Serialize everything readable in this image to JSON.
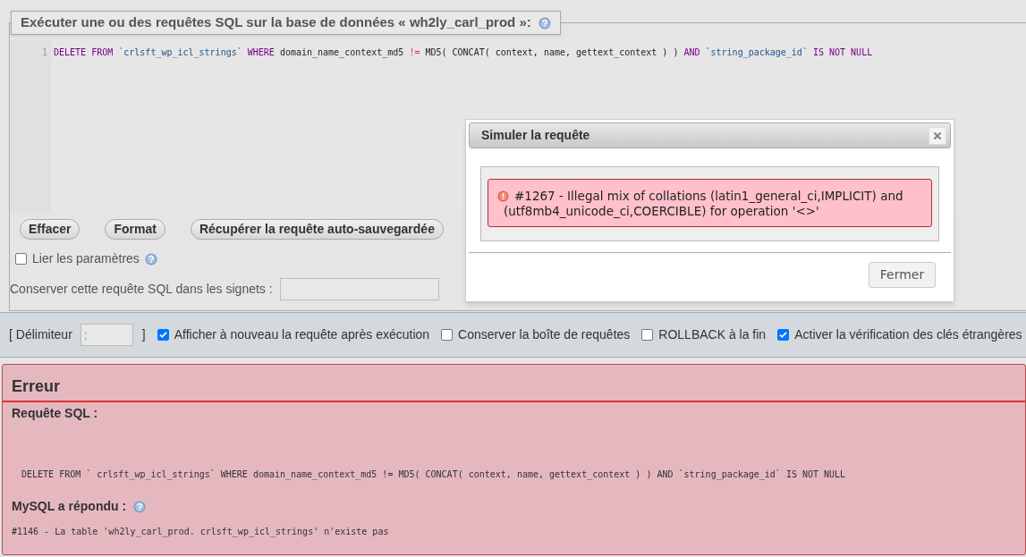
{
  "query_box": {
    "legend": "Exécuter une ou des requêtes SQL sur la base de données « wh2ly_carl_prod »:",
    "editor": {
      "line_numbers": [
        "1"
      ],
      "lines": [
        [
          {
            "kind": "keyword",
            "text": "DELETE FROM"
          },
          {
            "kind": "string",
            "text": " `crlsft_wp_icl_strings`"
          },
          {
            "kind": "keyword",
            "text": " WHERE"
          },
          {
            "kind": "plain",
            "text": " domain_name_context_md5 "
          },
          {
            "kind": "operator",
            "text": "!="
          },
          {
            "kind": "plain",
            "text": " MD5( CONCAT( context, name, gettext_context ) ) "
          },
          {
            "kind": "keyword",
            "text": "AND"
          },
          {
            "kind": "string",
            "text": " `string_package_id`"
          },
          {
            "kind": "keyword",
            "text": " IS NOT NULL"
          }
        ]
      ]
    },
    "buttons": [
      "Effacer",
      "Format",
      "Récupérer la requête auto-sauvegardée"
    ],
    "bind_parameters": {
      "label": "Lier les paramètres",
      "checked": false
    },
    "bookmark": {
      "label": "Conserver cette requête SQL dans les signets :"
    }
  },
  "options": {
    "delimiter_open": "[ Délimiteur",
    "delimiter_value": ";",
    "delimiter_close": "]",
    "checkboxes": [
      {
        "label": "Afficher à nouveau la requête après exécution",
        "checked": true
      },
      {
        "label": "Conserver la boîte de requêtes",
        "checked": false
      },
      {
        "label": "ROLLBACK à la fin",
        "checked": false
      },
      {
        "label": "Activer la vérification des clés étrangères",
        "checked": true
      }
    ]
  },
  "error_panel": {
    "title": "Erreur",
    "query_heading": "Requête SQL :",
    "query": "DELETE FROM ` crlsft_wp_icl_strings` WHERE domain_name_context_md5 != MD5( CONCAT( context, name, gettext_context ) ) AND `string_package_id` IS NOT NULL",
    "response_heading": "MySQL a répondu :",
    "response": "#1146 - La table 'wh2ly_carl_prod. crlsft_wp_icl_strings' n'existe pas"
  },
  "dialog": {
    "title": "Simuler la requête",
    "message": "#1267 - Illegal mix of collations (latin1_general_ci,IMPLICIT) and (utf8mb4_unicode_ci,COERCIBLE) for operation '<>'",
    "close_button": "Fermer"
  }
}
